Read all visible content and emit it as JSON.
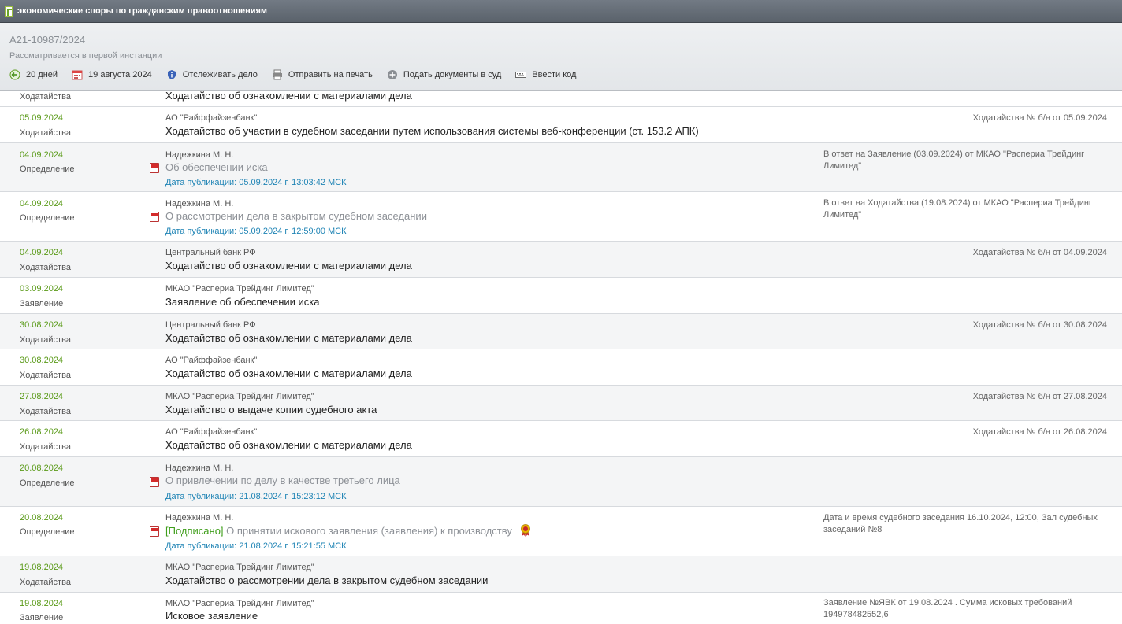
{
  "window": {
    "title": "экономические споры по гражданским правоотношениям"
  },
  "case": {
    "number": "А21-10987/2024",
    "status": "Рассматривается в первой инстанции"
  },
  "toolbar": {
    "days": "20 дней",
    "date": "19 августа 2024",
    "track": "Отслеживать дело",
    "print": "Отправить на печать",
    "submit": "Подать документы в суд",
    "code": "Ввести код"
  },
  "rows": [
    {
      "type": "Ходатайства",
      "title": "Ходатайство об ознакомлении с материалами дела"
    },
    {
      "date": "05.09.2024",
      "type": "Ходатайства",
      "org": "АО \"Райффайзенбанк\"",
      "title": "Ходатайство об участии в судебном заседании путем использования системы веб-конференции (ст. 153.2 АПК)",
      "note": "Ходатайства № б/н от 05.09.2024"
    },
    {
      "date": "04.09.2024",
      "type": "Определение",
      "org": "Надежкина М. Н.",
      "title": "Об обеспечении иска",
      "pub": "Дата публикации: 05.09.2024 г. 13:03:42 МСК",
      "note": "В ответ на Заявление (03.09.2024) от МКАО \"Распериа Трейдинг Лимитед\""
    },
    {
      "date": "04.09.2024",
      "type": "Определение",
      "org": "Надежкина М. Н.",
      "title": "О рассмотрении дела в закрытом судебном заседании",
      "pub": "Дата публикации: 05.09.2024 г. 12:59:00 МСК",
      "note": "В ответ на Ходатайства (19.08.2024) от МКАО \"Распериа Трейдинг Лимитед\""
    },
    {
      "date": "04.09.2024",
      "type": "Ходатайства",
      "org": "Центральный банк РФ",
      "title": "Ходатайство об ознакомлении с материалами дела",
      "note": "Ходатайства № б/н от 04.09.2024"
    },
    {
      "date": "03.09.2024",
      "type": "Заявление",
      "org": "МКАО \"Распериа Трейдинг Лимитед\"",
      "title": "Заявление об обеспечении иска"
    },
    {
      "date": "30.08.2024",
      "type": "Ходатайства",
      "org": "Центральный банк РФ",
      "title": "Ходатайство об ознакомлении с материалами дела",
      "note": "Ходатайства № б/н от 30.08.2024"
    },
    {
      "date": "30.08.2024",
      "type": "Ходатайства",
      "org": "АО \"Райффайзенбанк\"",
      "title": "Ходатайство об ознакомлении с материалами дела"
    },
    {
      "date": "27.08.2024",
      "type": "Ходатайства",
      "org": "МКАО \"Распериа Трейдинг Лимитед\"",
      "title": "Ходатайство о выдаче копии судебного акта",
      "note": "Ходатайства № б/н от 27.08.2024"
    },
    {
      "date": "26.08.2024",
      "type": "Ходатайства",
      "org": "АО \"Райффайзенбанк\"",
      "title": "Ходатайство об ознакомлении с материалами дела",
      "note": "Ходатайства № б/н от 26.08.2024"
    },
    {
      "date": "20.08.2024",
      "type": "Определение",
      "org": "Надежкина М. Н.",
      "title": "О привлечении по делу в качестве третьего лица",
      "pub": "Дата публикации: 21.08.2024 г. 15:23:12 МСК"
    },
    {
      "date": "20.08.2024",
      "type": "Определение",
      "org": "Надежкина М. Н.",
      "signed": "[Подписано]",
      "title": "О принятии искового заявления (заявления) к производству",
      "pub": "Дата публикации: 21.08.2024 г. 15:21:55 МСК",
      "note": "Дата и время судебного заседания 16.10.2024, 12:00, Зал судебных заседаний №8"
    },
    {
      "date": "19.08.2024",
      "type": "Ходатайства",
      "org": "МКАО \"Распериа Трейдинг Лимитед\"",
      "title": "Ходатайство о рассмотрении дела в закрытом судебном заседании"
    },
    {
      "date": "19.08.2024",
      "type": "Заявление",
      "org": "МКАО \"Распериа Трейдинг Лимитед\"",
      "title": "Исковое заявление",
      "note": "Заявление №ЯВК от 19.08.2024 . Сумма исковых требований 194978482552,6"
    }
  ]
}
